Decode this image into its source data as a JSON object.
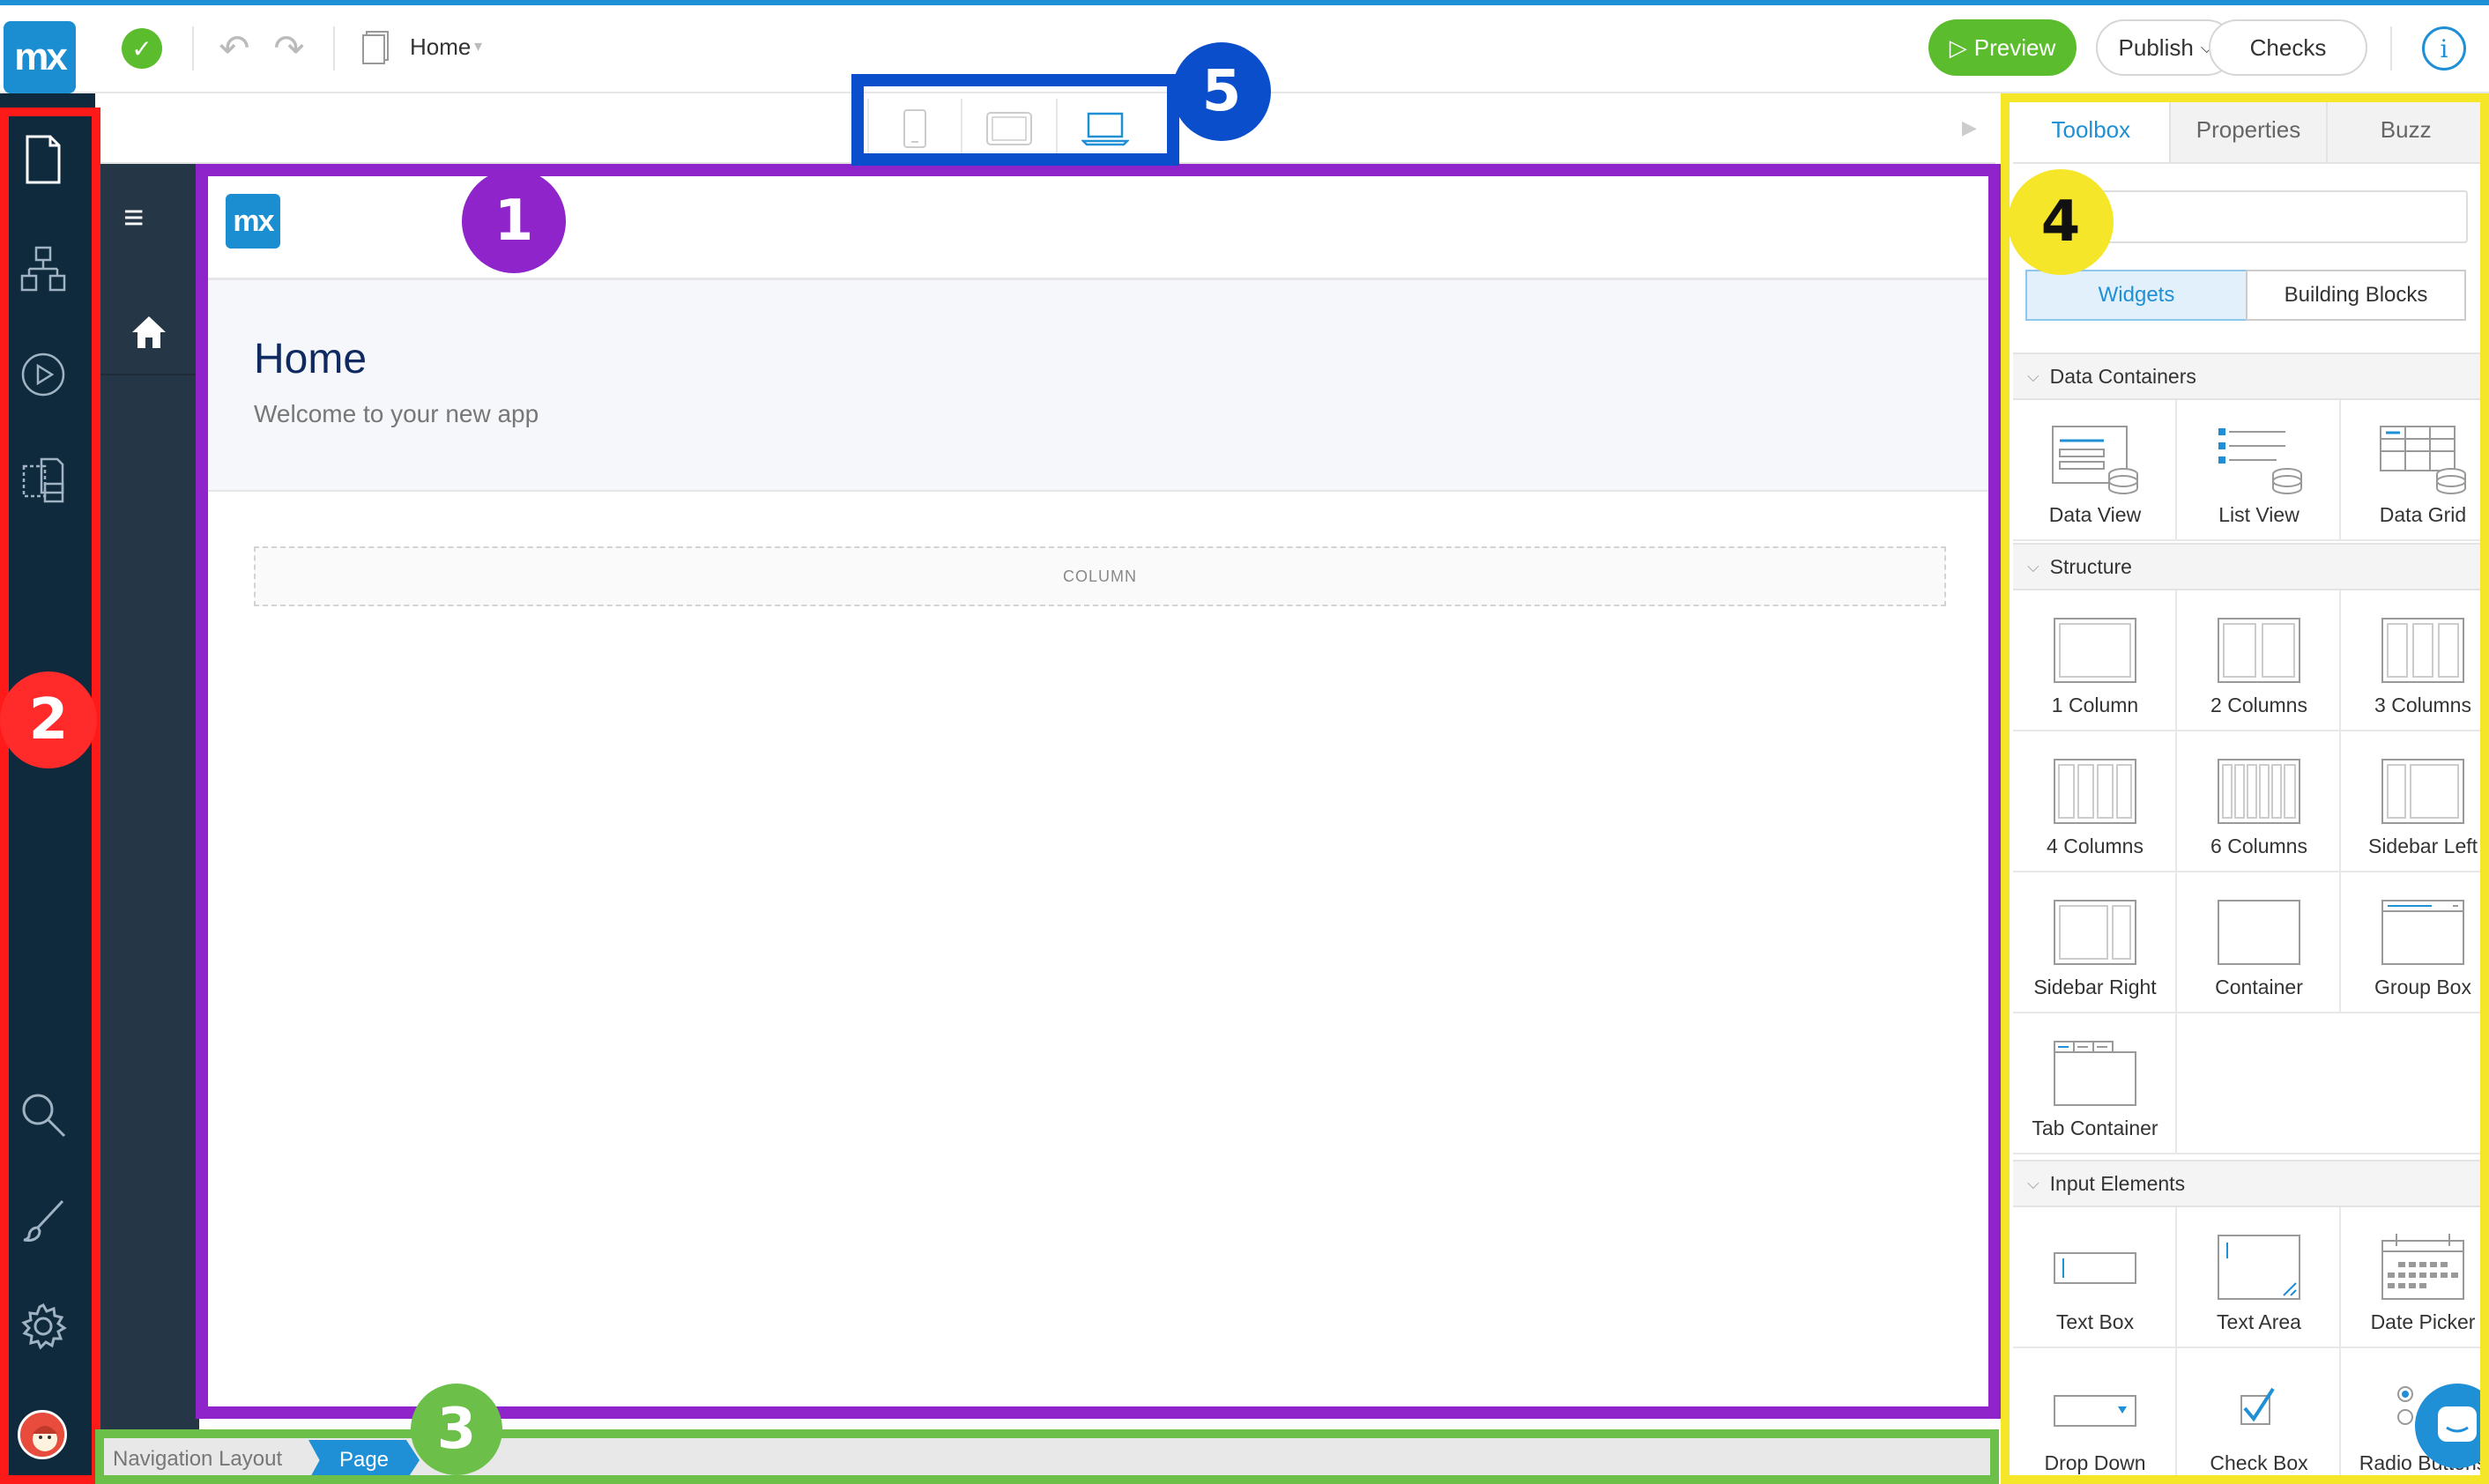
{
  "app": {
    "logo": "mx",
    "status_icon": "check-icon",
    "page_name": "Home"
  },
  "toolbar": {
    "preview_label": "Preview",
    "publish_label": "Publish",
    "checks_label": "Checks",
    "info_label": "i"
  },
  "sidebar": {
    "items": [
      {
        "name": "pages-icon"
      },
      {
        "name": "domain-model-icon"
      },
      {
        "name": "microflows-icon"
      },
      {
        "name": "app-explorer-icon"
      },
      {
        "name": "search-icon"
      },
      {
        "name": "theme-brush-icon"
      },
      {
        "name": "settings-gear-icon"
      }
    ]
  },
  "canvas": {
    "app_logo": "mx",
    "title": "Home",
    "subtitle": "Welcome to your new app",
    "column_label": "COLUMN"
  },
  "breadcrumb": {
    "layout": "Navigation Layout",
    "page": "Page"
  },
  "panel": {
    "tabs": [
      "Toolbox",
      "Properties",
      "Buzz"
    ],
    "active_tab": "Toolbox",
    "segments": {
      "widgets": "Widgets",
      "building_blocks": "Building Blocks"
    },
    "categories": {
      "data_containers": "Data Containers",
      "structure": "Structure",
      "input_elements": "Input Elements"
    },
    "data_containers": [
      "Data View",
      "List View",
      "Data Grid"
    ],
    "structure": [
      "1 Column",
      "2 Columns",
      "3 Columns",
      "4 Columns",
      "6 Columns",
      "Sidebar Left",
      "Sidebar Right",
      "Container",
      "Group Box",
      "Tab Container"
    ],
    "input_elements": [
      "Text Box",
      "Text Area",
      "Date Picker",
      "Drop Down",
      "Check Box",
      "Radio Buttons"
    ]
  },
  "markers": [
    "1",
    "2",
    "3",
    "4",
    "5"
  ],
  "colors": {
    "accent": "#1f8fd6",
    "preview_green": "#5bbd2e",
    "sidebar_bg": "#0f2a3d",
    "marker_purple": "#8e24c9",
    "marker_red": "#ff1a1a",
    "marker_green": "#6cc04a",
    "marker_yellow": "#f5e62a",
    "marker_blue": "#0b4ecc"
  }
}
